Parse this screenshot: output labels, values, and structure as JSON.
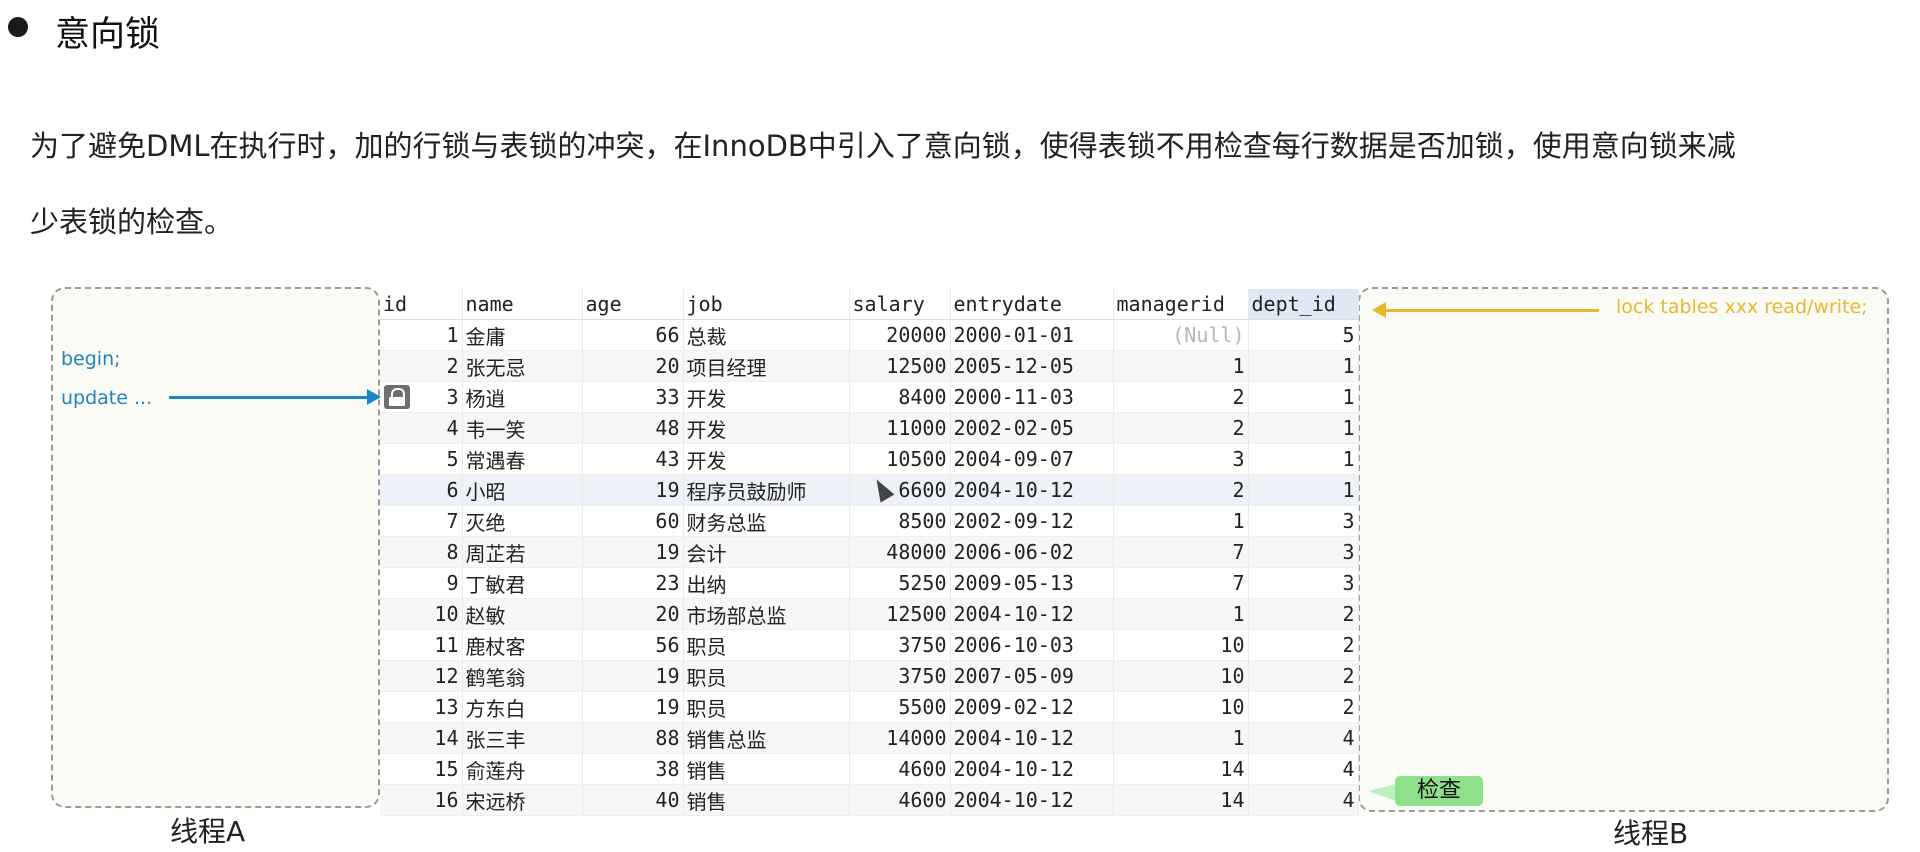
{
  "title": "意向锁",
  "paragraph": [
    "为了避免DML在执行时，加的行锁与表锁的冲突，在InnoDB中引入了意向锁，使得表锁不用检查每行数据是否加锁，使用意向锁来减",
    "少表锁的检查。"
  ],
  "thread_a": {
    "label": "线程A",
    "line1": "begin;",
    "line2": "update ..."
  },
  "thread_b": {
    "label": "线程B",
    "command": "lock tables xxx read/write;",
    "check_badge": "检查"
  },
  "colors": {
    "thread_a_blue": "#1b86c2",
    "thread_b_yellow": "#e8b72d",
    "check_green": "#8fe08a"
  },
  "table": {
    "columns": [
      "id",
      "name",
      "age",
      "job",
      "salary",
      "entrydate",
      "managerid",
      "dept_id"
    ],
    "selected_column": "dept_id",
    "locked_row_id": "3",
    "rows": [
      [
        "1",
        "金庸",
        "66",
        "总裁",
        "20000",
        "2000-01-01",
        "(Null)",
        "5"
      ],
      [
        "2",
        "张无忌",
        "20",
        "项目经理",
        "12500",
        "2005-12-05",
        "1",
        "1"
      ],
      [
        "3",
        "杨逍",
        "33",
        "开发",
        "8400",
        "2000-11-03",
        "2",
        "1"
      ],
      [
        "4",
        "韦一笑",
        "48",
        "开发",
        "11000",
        "2002-02-05",
        "2",
        "1"
      ],
      [
        "5",
        "常遇春",
        "43",
        "开发",
        "10500",
        "2004-09-07",
        "3",
        "1"
      ],
      [
        "6",
        "小昭",
        "19",
        "程序员鼓励师",
        "6600",
        "2004-10-12",
        "2",
        "1"
      ],
      [
        "7",
        "灭绝",
        "60",
        "财务总监",
        "8500",
        "2002-09-12",
        "1",
        "3"
      ],
      [
        "8",
        "周芷若",
        "19",
        "会计",
        "48000",
        "2006-06-02",
        "7",
        "3"
      ],
      [
        "9",
        "丁敏君",
        "23",
        "出纳",
        "5250",
        "2009-05-13",
        "7",
        "3"
      ],
      [
        "10",
        "赵敏",
        "20",
        "市场部总监",
        "12500",
        "2004-10-12",
        "1",
        "2"
      ],
      [
        "11",
        "鹿杖客",
        "56",
        "职员",
        "3750",
        "2006-10-03",
        "10",
        "2"
      ],
      [
        "12",
        "鹤笔翁",
        "19",
        "职员",
        "3750",
        "2007-05-09",
        "10",
        "2"
      ],
      [
        "13",
        "方东白",
        "19",
        "职员",
        "5500",
        "2009-02-12",
        "10",
        "2"
      ],
      [
        "14",
        "张三丰",
        "88",
        "销售总监",
        "14000",
        "2004-10-12",
        "1",
        "4"
      ],
      [
        "15",
        "俞莲舟",
        "38",
        "销售",
        "4600",
        "2004-10-12",
        "14",
        "4"
      ],
      [
        "16",
        "宋远桥",
        "40",
        "销售",
        "4600",
        "2004-10-12",
        "14",
        "4"
      ]
    ]
  }
}
